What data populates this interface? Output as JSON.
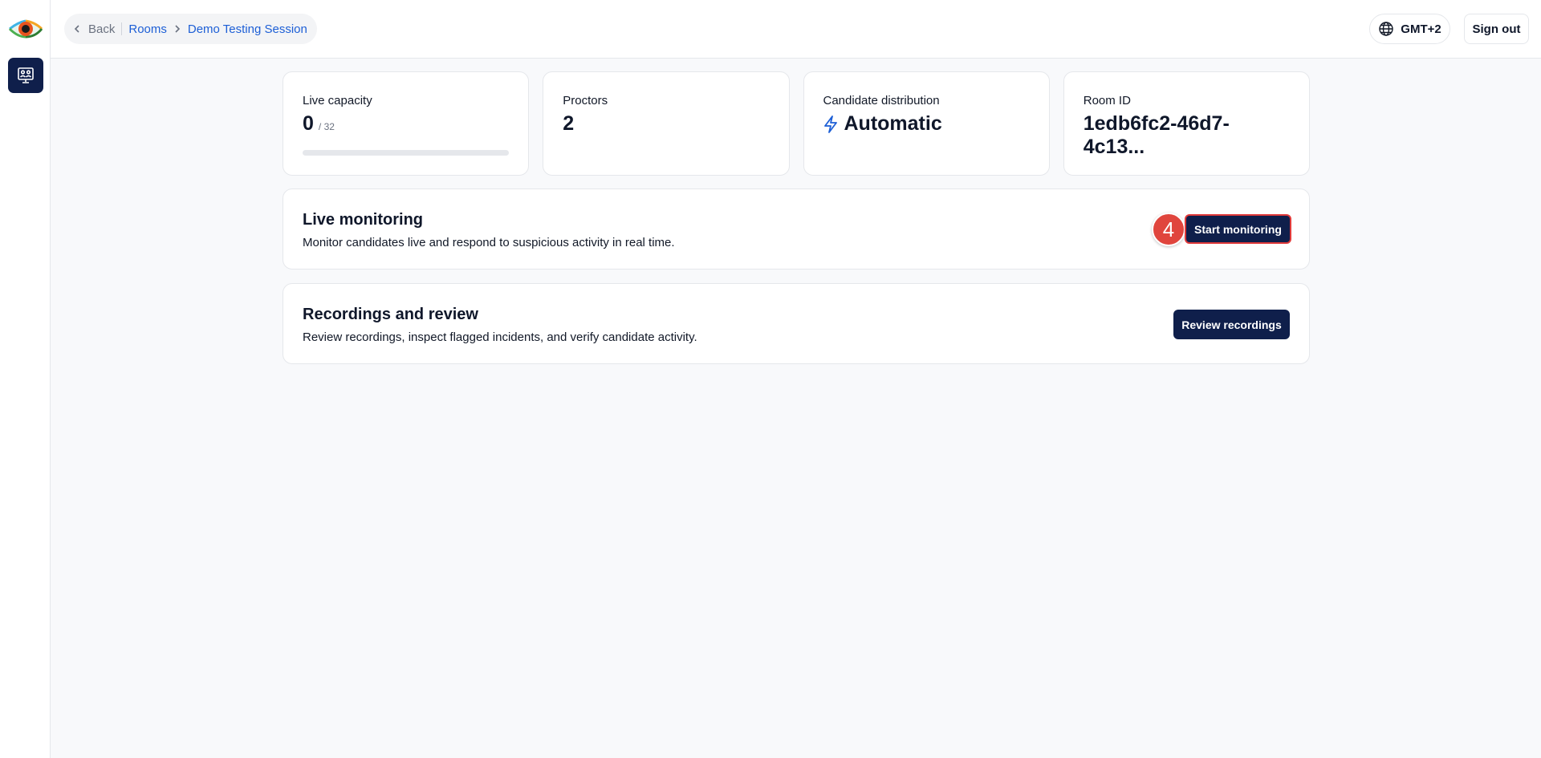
{
  "breadcrumb": {
    "back_label": "Back",
    "rooms_label": "Rooms",
    "current_label": "Demo Testing Session"
  },
  "header": {
    "timezone_label": "GMT+2",
    "signout_label": "Sign out"
  },
  "stats": {
    "live_capacity": {
      "label": "Live capacity",
      "value": "0",
      "sub": "/ 32",
      "fill_fraction": 0
    },
    "proctors": {
      "label": "Proctors",
      "value": "2"
    },
    "distribution": {
      "label": "Candidate distribution",
      "value": "Automatic",
      "icon": "lightning-icon"
    },
    "room_id": {
      "label": "Room ID",
      "value": "1edb6fc2-46d7-4c13..."
    }
  },
  "live_monitoring": {
    "title": "Live monitoring",
    "description": "Monitor candidates live and respond to suspicious activity in real time.",
    "button_label": "Start monitoring",
    "step_badge": "4"
  },
  "recordings": {
    "title": "Recordings and review",
    "description": "Review recordings, inspect flagged incidents, and verify candidate activity.",
    "button_label": "Review recordings"
  },
  "colors": {
    "primary": "#0f1f4b",
    "link": "#1d5fd6",
    "highlight": "#e03a3a",
    "badge": "#e0453d"
  }
}
